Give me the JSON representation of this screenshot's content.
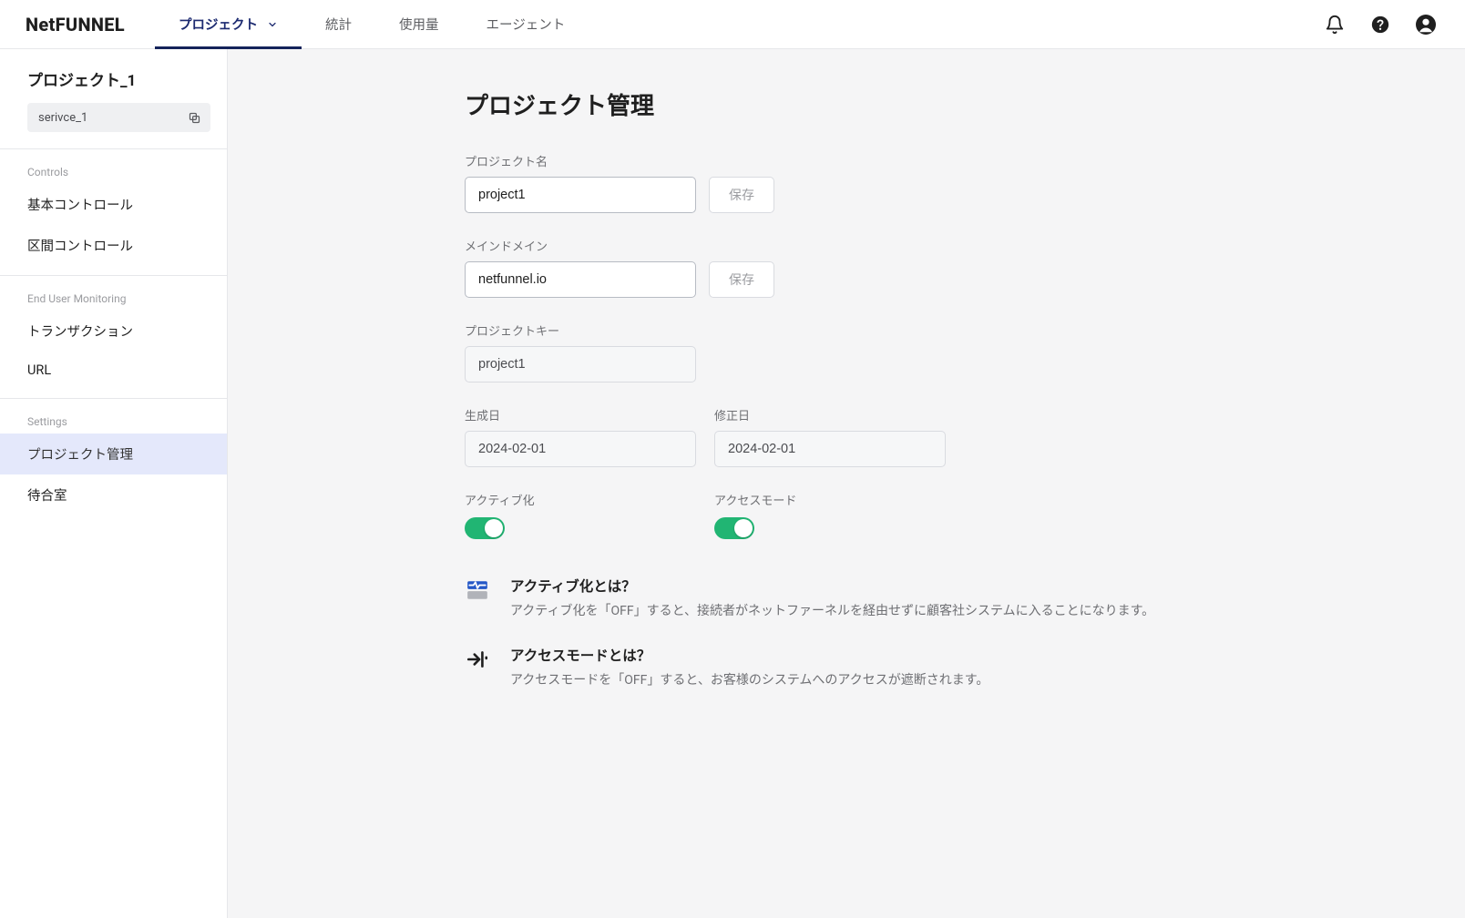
{
  "logo": "NetFUNNEL",
  "nav": {
    "project": "プロジェクト",
    "stats": "統計",
    "usage": "使用量",
    "agent": "エージェント"
  },
  "sidebar": {
    "project_name": "プロジェクト_1",
    "service_id": "serivce_1",
    "sections": {
      "controls_label": "Controls",
      "controls": {
        "basic": "基本コントロール",
        "segment": "区間コントロール"
      },
      "eum_label": "End User Monitoring",
      "eum": {
        "transaction": "トランザクション",
        "url": "URL"
      },
      "settings_label": "Settings",
      "settings": {
        "project_manage": "プロジェクト管理",
        "waiting_room": "待合室"
      }
    }
  },
  "main": {
    "title": "プロジェクト管理",
    "project_name": {
      "label": "プロジェクト名",
      "value": "project1",
      "save": "保存"
    },
    "main_domain": {
      "label": "メインドメイン",
      "value": "netfunnel.io",
      "save": "保存"
    },
    "project_key": {
      "label": "プロジェクトキー",
      "value": "project1"
    },
    "created_at": {
      "label": "生成日",
      "value": "2024-02-01"
    },
    "updated_at": {
      "label": "修正日",
      "value": "2024-02-01"
    },
    "activation": {
      "label": "アクティブ化",
      "on": true
    },
    "access_mode": {
      "label": "アクセスモード",
      "on": true
    },
    "info_activation": {
      "title": "アクティブ化とは？",
      "desc": "アクティブ化を「OFF」すると、接続者がネットファーネルを経由せずに顧客社システムに入ることになります。"
    },
    "info_access": {
      "title": "アクセスモードとは？",
      "desc": "アクセスモードを「OFF」すると、お客様のシステムへのアクセスが遮断されます。"
    }
  },
  "colors": {
    "accent_nav": "#14235a",
    "toggle_on": "#21b573",
    "sidebar_selected_bg": "#e4e8fb"
  }
}
